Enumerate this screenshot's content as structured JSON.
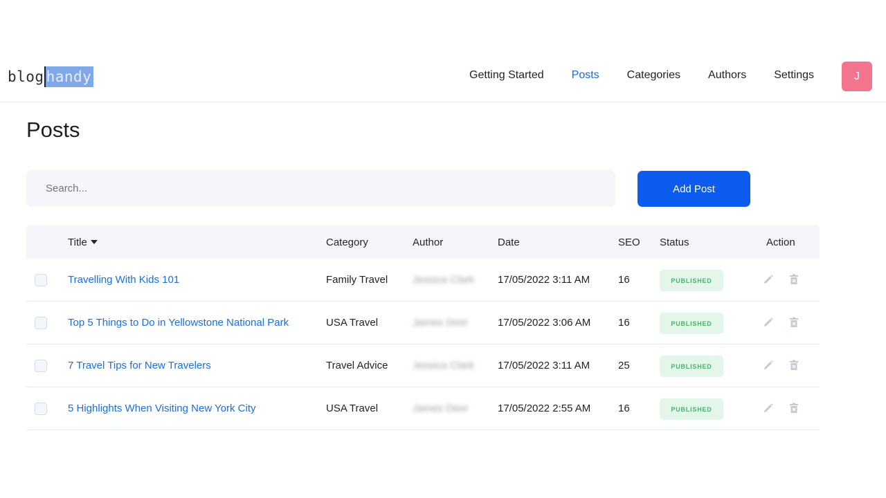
{
  "header": {
    "logo_part1": "blog",
    "logo_part2": "handy",
    "nav": [
      {
        "label": "Getting Started",
        "active": false
      },
      {
        "label": "Posts",
        "active": true
      },
      {
        "label": "Categories",
        "active": false
      },
      {
        "label": "Authors",
        "active": false
      },
      {
        "label": "Settings",
        "active": false
      }
    ],
    "avatar_initial": "J"
  },
  "page": {
    "title": "Posts",
    "search_placeholder": "Search...",
    "add_button": "Add Post"
  },
  "table": {
    "columns": {
      "title": "Title",
      "category": "Category",
      "author": "Author",
      "date": "Date",
      "seo": "SEO",
      "status": "Status",
      "action": "Action"
    },
    "rows": [
      {
        "title": "Travelling With Kids 101",
        "category": "Family Travel",
        "author": "Jessica Clark",
        "date": "17/05/2022 3:11 AM",
        "seo": "16",
        "status": "PUBLISHED"
      },
      {
        "title": "Top 5 Things to Do in Yellowstone National Park",
        "category": "USA Travel",
        "author": "James Deer",
        "date": "17/05/2022 3:06 AM",
        "seo": "16",
        "status": "PUBLISHED"
      },
      {
        "title": "7 Travel Tips for New Travelers",
        "category": "Travel Advice",
        "author": "Jessica Clark",
        "date": "17/05/2022 3:11 AM",
        "seo": "25",
        "status": "PUBLISHED"
      },
      {
        "title": "5 Highlights When Visiting New York City",
        "category": "USA Travel",
        "author": "James Deer",
        "date": "17/05/2022 2:55 AM",
        "seo": "16",
        "status": "PUBLISHED"
      }
    ]
  },
  "colors": {
    "accent": "#1767e8",
    "button": "#0d5cf0",
    "avatar": "#f4738f",
    "badge_bg": "#e4f6ea",
    "badge_text": "#46b36b"
  }
}
